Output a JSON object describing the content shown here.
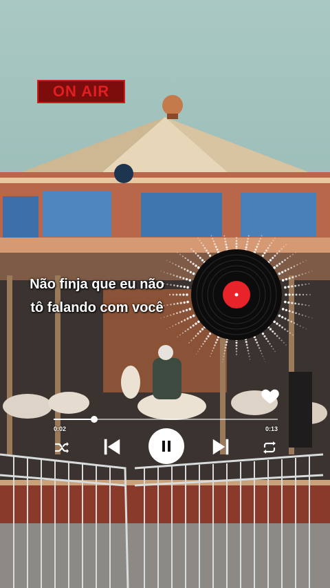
{
  "overlay": {
    "badge_text": "ON AIR"
  },
  "lyrics": {
    "line1": "Não finja que eu não",
    "line2": "tô falando com você"
  },
  "player": {
    "elapsed": "0:02",
    "duration": "0:13",
    "progress": 0.18,
    "liked": true,
    "state": "playing"
  },
  "icons": {
    "shuffle": "shuffle-icon",
    "previous": "skip-previous-icon",
    "pause": "pause-icon",
    "next": "skip-next-icon",
    "repeat": "repeat-icon",
    "like": "heart-icon",
    "record": "vinyl-record-icon"
  },
  "colors": {
    "badge": "#c91e1e",
    "record_label": "#e8242a",
    "controls": "#ffffff"
  }
}
